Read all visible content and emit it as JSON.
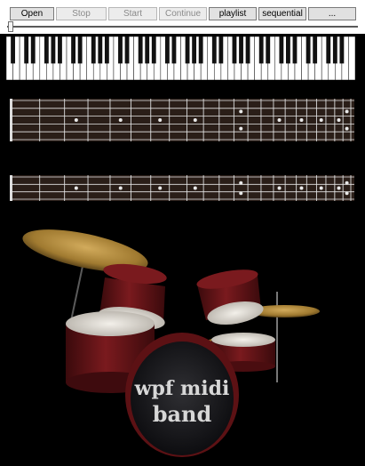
{
  "toolbar": {
    "open_label": "Open",
    "stop_label": "Stop",
    "start_label": "Start",
    "continue_label": "Continue",
    "playlist_label": "playlist",
    "sequential_label": "sequential",
    "more_label": "..."
  },
  "progress": {
    "value": 0.0
  },
  "piano": {
    "white_key_count": 52
  },
  "guitar": {
    "strings": 6
  },
  "bass": {
    "strings": 4
  },
  "drums": {
    "logo_line1": "wpf midi",
    "logo_line2": "band"
  },
  "colors": {
    "drum_shell": "#6e1418",
    "cymbal": "#b08a3a",
    "fretboard_wood": "#2a1e18",
    "background": "#000000"
  }
}
